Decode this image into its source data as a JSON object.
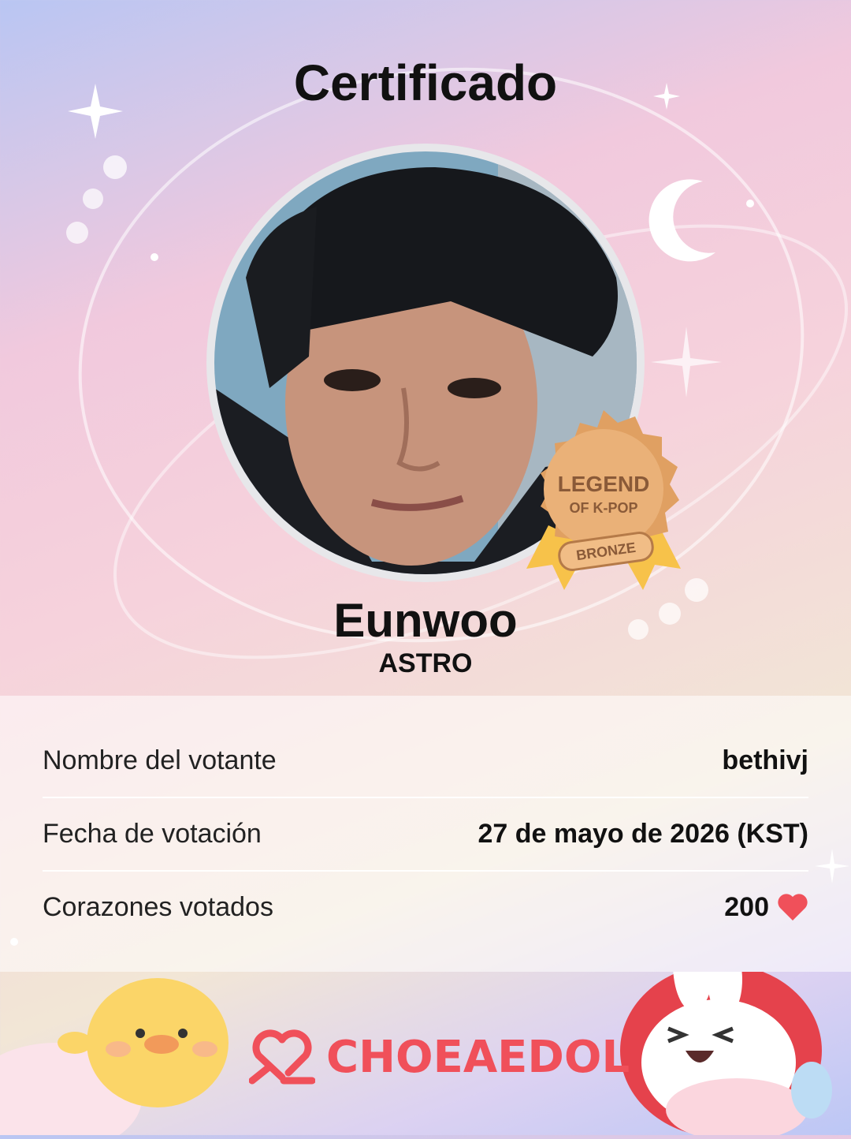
{
  "header": {
    "title": "Certificado"
  },
  "idol": {
    "name": "Eunwoo",
    "group": "ASTRO"
  },
  "badge": {
    "line1": "LEGEND",
    "line2": "OF K-POP",
    "tier": "BRONZE",
    "icon": "medal-icon"
  },
  "details": {
    "voter_label": "Nombre del votante",
    "voter_value": "bethivj",
    "date_label": "Fecha de votación",
    "date_value": "27 de mayo de 2026 (KST)",
    "hearts_label": "Corazones votados",
    "hearts_value": "200",
    "hearts_icon": "heart-icon"
  },
  "footer": {
    "brand": "CHOEAEDOL",
    "brand_icon": "choeaedol-logo-icon"
  },
  "colors": {
    "brand_red": "#f0505a",
    "heart": "#f0505a",
    "medal_bronze": "#e0a062",
    "ribbon": "#f7c24a"
  }
}
